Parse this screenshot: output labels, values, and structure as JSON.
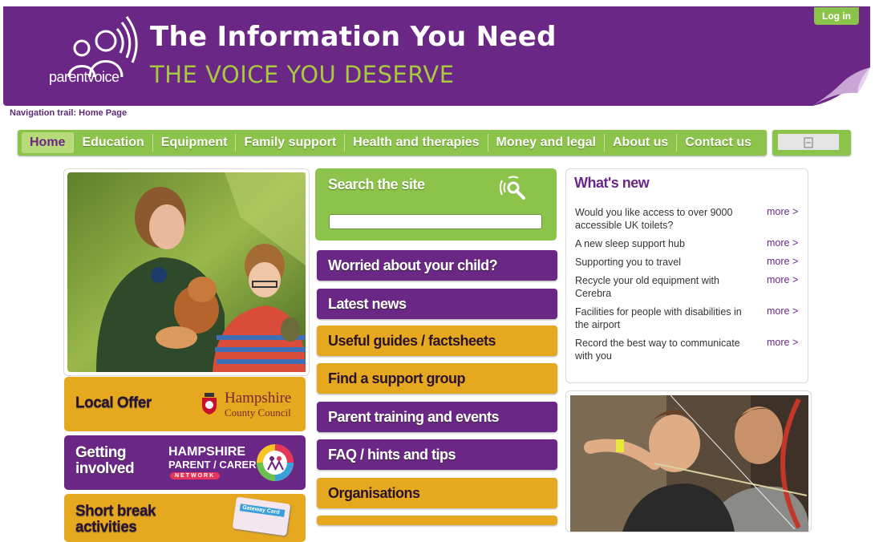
{
  "header": {
    "logo_text": "parentvoice",
    "tagline_main": "The Information You Need",
    "tagline_sub": "THE VOICE YOU DESERVE",
    "login_label": "Log in"
  },
  "breadcrumb": "Navigation trail: Home Page",
  "nav": {
    "items": [
      {
        "label": "Home"
      },
      {
        "label": "Education"
      },
      {
        "label": "Equipment"
      },
      {
        "label": "Family support"
      },
      {
        "label": "Health and therapies"
      },
      {
        "label": "Money and legal"
      },
      {
        "label": "About us"
      },
      {
        "label": "Contact us"
      }
    ]
  },
  "left": {
    "local_offer": "Local Offer",
    "hampshire_line1": "Hampshire",
    "hampshire_line2": "County Council",
    "getting_involved_line1": "Getting",
    "getting_involved_line2": "involved",
    "network_line1": "HAMPSHIRE",
    "network_line2": "PARENT / CARER",
    "network_line3": "NETWORK",
    "short_break_line1": "Short break",
    "short_break_line2": "activities",
    "card_text": "Gateway Card"
  },
  "middle": {
    "search_title": "Search the site",
    "search_placeholder": "",
    "menu": [
      {
        "label": "Worried about your child?"
      },
      {
        "label": "Latest news"
      },
      {
        "label": "Useful guides / factsheets"
      },
      {
        "label": "Find a support group"
      },
      {
        "label": "Parent training and events"
      },
      {
        "label": "FAQ / hints and tips"
      },
      {
        "label": "Organisations"
      }
    ]
  },
  "whats_new": {
    "title": "What's new",
    "more_label": "more >",
    "items": [
      {
        "text": "Would you like access to over 9000 accessible UK toilets?"
      },
      {
        "text": "A new sleep support hub"
      },
      {
        "text": "Supporting you to travel"
      },
      {
        "text": "Recycle your old equipment with Cerebra"
      },
      {
        "text": "Facilities for people with disabilities in the airport"
      },
      {
        "text": "Record the best way to communicate with you"
      }
    ]
  },
  "colors": {
    "purple": "#6b2785",
    "green": "#8cc34a",
    "gold": "#e6a81e",
    "lime_text": "#a7c93e"
  }
}
